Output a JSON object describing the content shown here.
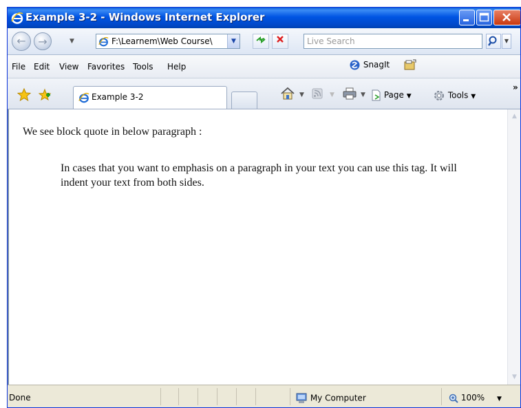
{
  "window": {
    "title": "Example 3-2 - Windows Internet Explorer"
  },
  "address_bar": {
    "url": "F:\\Learnem\\Web Course\\",
    "search_placeholder": "Live Search"
  },
  "menu": {
    "items": [
      "File",
      "Edit",
      "View",
      "Favorites",
      "Tools",
      "Help"
    ],
    "snagit_label": "SnagIt"
  },
  "tabs": {
    "active_label": "Example 3-2"
  },
  "command_bar": {
    "page_label": "Page",
    "tools_label": "Tools",
    "overflow": "»"
  },
  "content": {
    "paragraph": "We see block quote in below paragraph :",
    "blockquote": "In cases that you want to emphasis on a paragraph in your text you can use this tag. It will indent your text from both sides."
  },
  "status_bar": {
    "status": "Done",
    "zone": "My Computer",
    "zoom": "100%"
  }
}
